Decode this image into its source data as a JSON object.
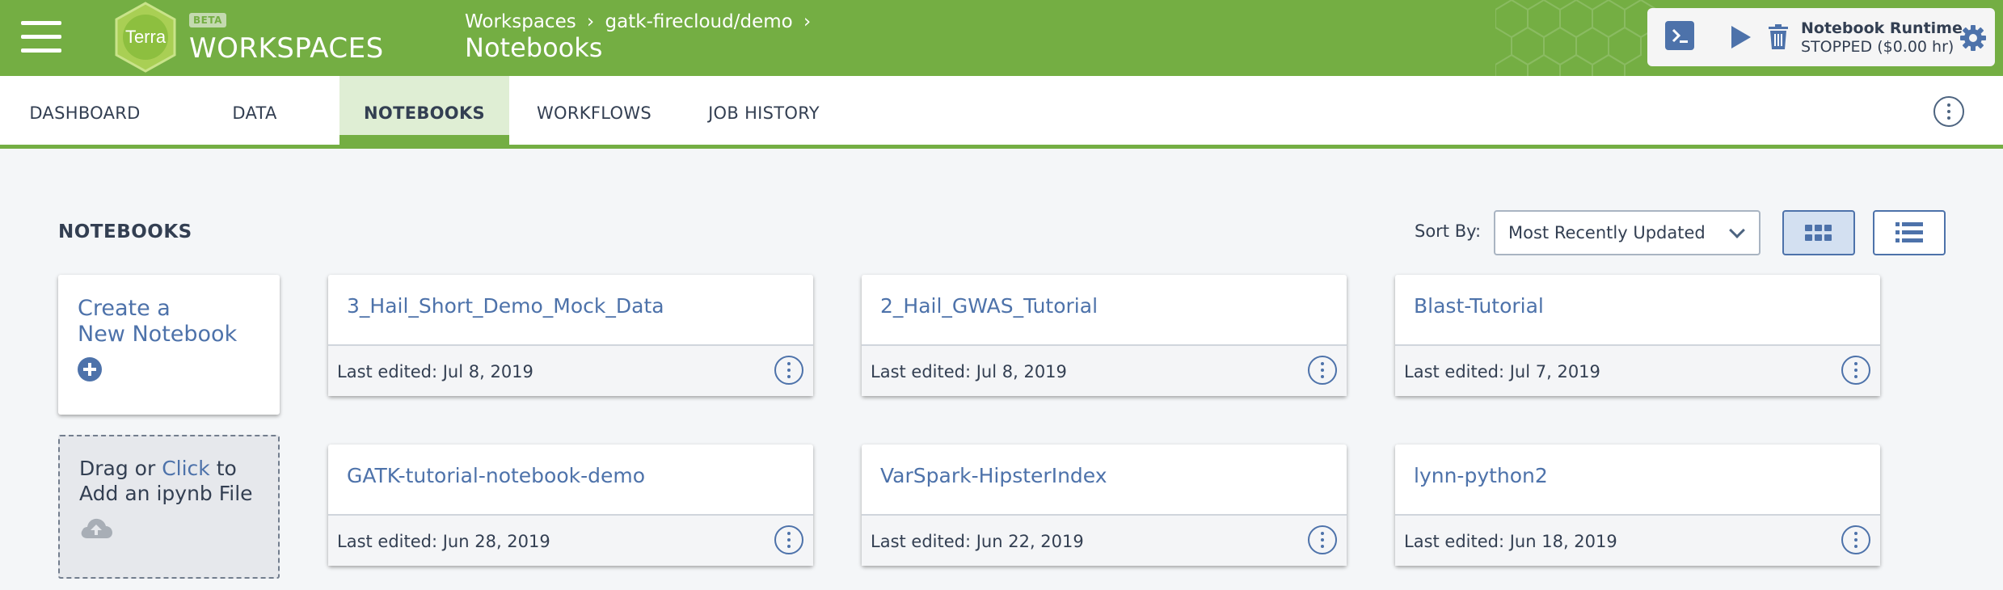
{
  "header": {
    "logo_text": "Terra",
    "beta_badge": "BETA",
    "app_title": "WORKSPACES",
    "breadcrumb": [
      "Workspaces",
      "gatk-firecloud/demo"
    ],
    "breadcrumb_separator": "›",
    "page_title": "Notebooks",
    "runtime": {
      "title": "Notebook Runtime",
      "status": "STOPPED ($0.00 hr)"
    },
    "colors": {
      "brand_green": "#74ae43",
      "accent_blue": "#4d72aa"
    }
  },
  "tabs": [
    {
      "label": "DASHBOARD",
      "active": false
    },
    {
      "label": "DATA",
      "active": false
    },
    {
      "label": "NOTEBOOKS",
      "active": true
    },
    {
      "label": "WORKFLOWS",
      "active": false
    },
    {
      "label": "JOB HISTORY",
      "active": false
    }
  ],
  "main": {
    "section_title": "NOTEBOOKS",
    "sort": {
      "label": "Sort By:",
      "selected": "Most Recently Updated"
    },
    "views": [
      "grid-view",
      "list-view"
    ],
    "create_card": {
      "line1": "Create a",
      "line2": "New Notebook"
    },
    "upload_card": {
      "prefix": "Drag or ",
      "link": "Click",
      "suffix": " to",
      "line2": "Add an ipynb File"
    },
    "notebooks": [
      {
        "name": "3_Hail_Short_Demo_Mock_Data",
        "edited": "Last edited: Jul 8, 2019"
      },
      {
        "name": "2_Hail_GWAS_Tutorial",
        "edited": "Last edited: Jul 8, 2019"
      },
      {
        "name": "Blast-Tutorial",
        "edited": "Last edited: Jul 7, 2019"
      },
      {
        "name": "GATK-tutorial-notebook-demo",
        "edited": "Last edited: Jun 28, 2019"
      },
      {
        "name": "VarSpark-HipsterIndex",
        "edited": "Last edited: Jun 22, 2019"
      },
      {
        "name": "lynn-python2",
        "edited": "Last edited: Jun 18, 2019"
      }
    ]
  }
}
